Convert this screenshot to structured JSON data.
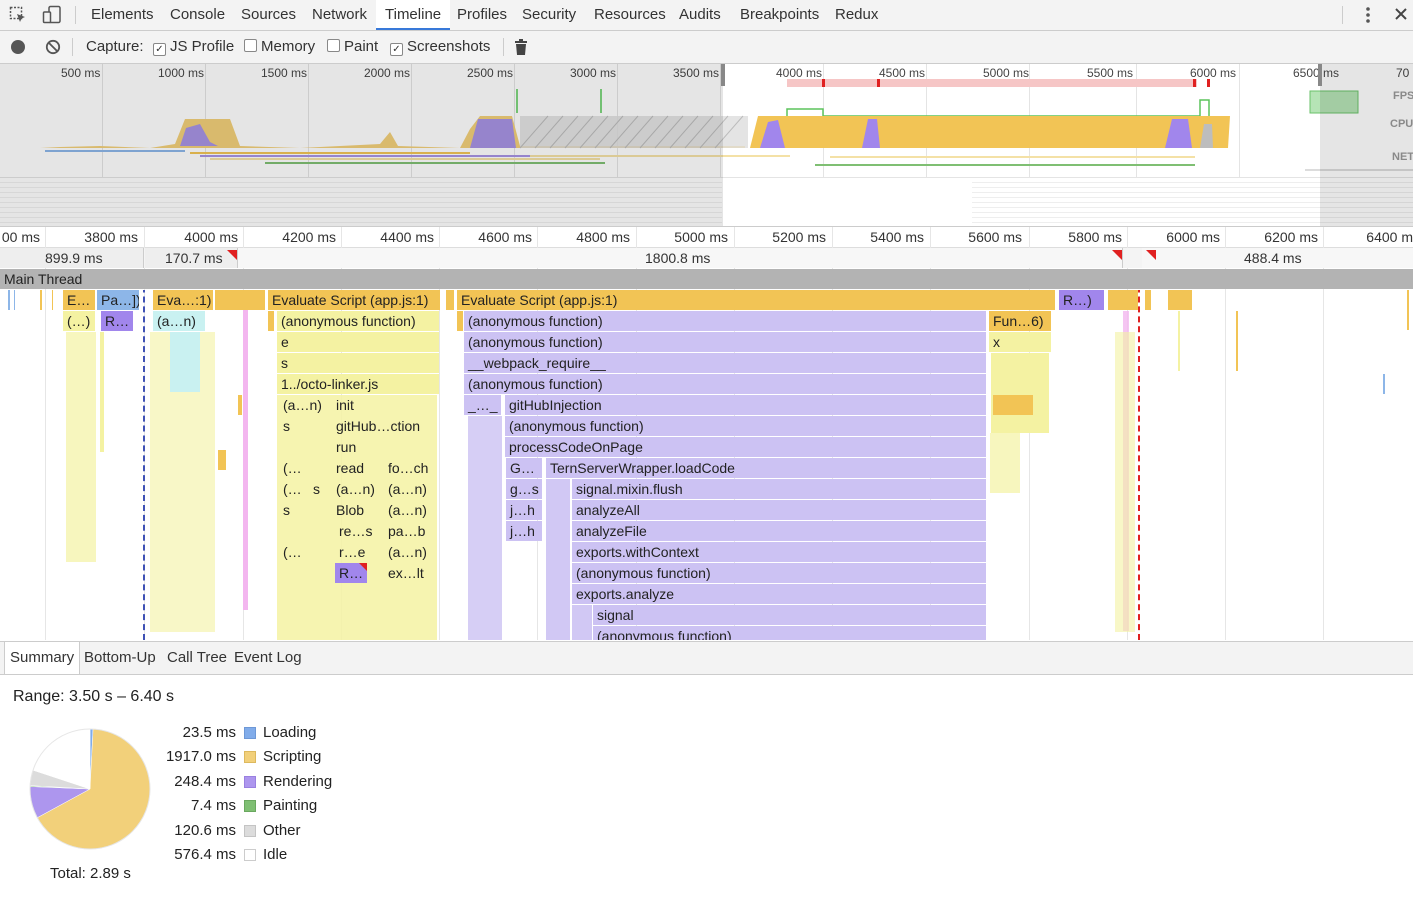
{
  "devtools": {
    "tabs": [
      "Elements",
      "Console",
      "Sources",
      "Network",
      "Timeline",
      "Profiles",
      "Security",
      "Resources",
      "Audits",
      "Breakpoints",
      "Redux"
    ],
    "active_tab": "Timeline"
  },
  "capture_bar": {
    "capture_label": "Capture:",
    "options": [
      {
        "label": "JS Profile",
        "checked": true
      },
      {
        "label": "Memory",
        "checked": false
      },
      {
        "label": "Paint",
        "checked": false
      },
      {
        "label": "Screenshots",
        "checked": true
      }
    ]
  },
  "overview": {
    "ticks": [
      "500 ms",
      "1000 ms",
      "1500 ms",
      "2000 ms",
      "2500 ms",
      "3000 ms",
      "3500 ms",
      "4000 ms",
      "4500 ms",
      "5000 ms",
      "5500 ms",
      "6000 ms",
      "6500 ms",
      "70"
    ],
    "track_labels": {
      "fps": "FPS",
      "cpu": "CPU",
      "net": "NET"
    }
  },
  "ruler": {
    "ticks": [
      "00 ms",
      "3800 ms",
      "4000 ms",
      "4200 ms",
      "4400 ms",
      "4600 ms",
      "4800 ms",
      "5000 ms",
      "5200 ms",
      "5400 ms",
      "5600 ms",
      "5800 ms",
      "6000 ms",
      "6200 ms",
      "6400 m"
    ]
  },
  "frames": [
    "899.9 ms",
    "170.7 ms",
    "1800.8 ms",
    "488.4 ms"
  ],
  "main_thread_label": "Main Thread",
  "flame": {
    "left_group": [
      "E…",
      "Pa…])",
      "(…)",
      "R…",
      "Eva…:1)",
      "(a…n)"
    ],
    "middle": {
      "top": "Evaluate Script (app.js:1)",
      "rows": [
        "(anonymous function)",
        "e",
        "s",
        "1../octo-linker.js"
      ],
      "col_a": [
        "(a…n)",
        "s",
        "(…",
        "(…",
        "s",
        "(…"
      ],
      "col_a_extra": "s",
      "col_b": [
        "init",
        "gitHub…ction",
        "run",
        "read",
        "(a…n)",
        "Blob",
        "re…s",
        "r…e",
        "R…"
      ],
      "col_c": [
        "fo…ch",
        "(a…n)",
        "(a…n)",
        "pa…b",
        "(a…n)",
        "ex…lt"
      ]
    },
    "right": {
      "top": "Evaluate Script (app.js:1)",
      "rows": [
        "(anonymous function)",
        "(anonymous function)",
        "__webpack_require__",
        "(anonymous function)"
      ],
      "short": "_…_",
      "gh_injection": "gitHubInjection",
      "deep": [
        "(anonymous function)",
        "processCodeOnPage",
        "TernServerWrapper.loadCode",
        "signal.mixin.flush",
        "analyzeAll",
        "analyzeFile",
        "exports.withContext",
        "(anonymous function)",
        "exports.analyze",
        "signal",
        "(anonymous function)"
      ],
      "side": [
        "G…",
        "g…s",
        "j…h",
        "j…h"
      ],
      "fun": "Fun…6)",
      "x": "x",
      "r": "R…)"
    }
  },
  "bottom_tabs": [
    "Summary",
    "Bottom-Up",
    "Call Tree",
    "Event Log"
  ],
  "summary": {
    "range": "Range: 3.50 s – 6.40 s",
    "total": "Total: 2.89 s",
    "categories": [
      {
        "name": "Loading",
        "value": "23.5 ms",
        "ms": 23.5,
        "color": "#81acea"
      },
      {
        "name": "Scripting",
        "value": "1917.0 ms",
        "ms": 1917.0,
        "color": "#f2d07a"
      },
      {
        "name": "Rendering",
        "value": "248.4 ms",
        "ms": 248.4,
        "color": "#ad96ee"
      },
      {
        "name": "Painting",
        "value": "7.4 ms",
        "ms": 7.4,
        "color": "#7fbf73"
      },
      {
        "name": "Other",
        "value": "120.6 ms",
        "ms": 120.6,
        "color": "#dcdcdc"
      },
      {
        "name": "Idle",
        "value": "576.4 ms",
        "ms": 576.4,
        "color": "#ffffff"
      }
    ]
  }
}
